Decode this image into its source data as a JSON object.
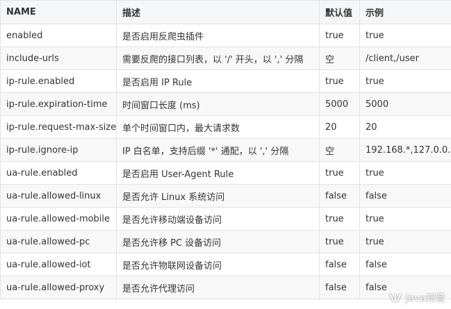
{
  "table": {
    "headers": [
      "NAME",
      "描述",
      "默认值",
      "示例"
    ],
    "rows": [
      [
        "enabled",
        "是否启用反爬虫插件",
        "true",
        "true"
      ],
      [
        "include-urls",
        "需要反爬的接口列表，以 '/' 开头，以 ',' 分隔",
        "空",
        "/client,/user"
      ],
      [
        "ip-rule.enabled",
        "是否启用 IP Rule",
        "true",
        "true"
      ],
      [
        "ip-rule.expiration-time",
        "时间窗口长度 (ms)",
        "5000",
        "5000"
      ],
      [
        "ip-rule.request-max-size",
        "单个时间窗口内，最大请求数",
        "20",
        "20"
      ],
      [
        "ip-rule.ignore-ip",
        "IP 白名单，支持后缀 '*' 通配，以 ',' 分隔",
        "空",
        "192.168.*,127.0.0.1"
      ],
      [
        "ua-rule.enabled",
        "是否启用 User-Agent Rule",
        "true",
        "true"
      ],
      [
        "ua-rule.allowed-linux",
        "是否允许 Linux 系统访问",
        "false",
        "false"
      ],
      [
        "ua-rule.allowed-mobile",
        "是否允许移动端设备访问",
        "true",
        "true"
      ],
      [
        "ua-rule.allowed-pc",
        "是否允许移 PC 设备访问",
        "true",
        "true"
      ],
      [
        "ua-rule.allowed-iot",
        "是否允许物联网设备访问",
        "false",
        "false"
      ],
      [
        "ua-rule.allowed-proxy",
        "是否允许代理访问",
        "false",
        "false"
      ]
    ]
  },
  "watermark": {
    "text": "Java知音",
    "icon": "wechat-channel-icon"
  }
}
